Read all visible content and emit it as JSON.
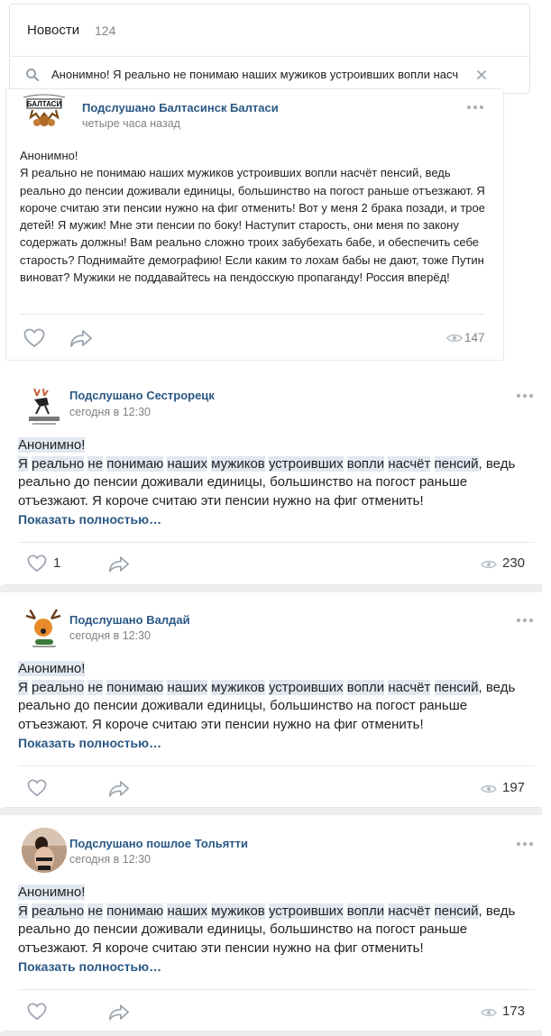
{
  "header": {
    "title": "Новости",
    "count": "124",
    "search_query": "Анонимно!  Я реально не понимаю наших мужиков устроивших вопли насч"
  },
  "posts": [
    {
      "author": "Подслушано Балтасинск Балтаси",
      "time": "четыре часа назад",
      "avatar_text": "БАЛТАСИ",
      "text": "Анонимно!\nЯ реально не понимаю наших мужиков устроивших вопли насчёт пенсий, ведь реально до пенсии доживали единицы, большинство на погост раньше отъезжают. Я короче считаю эти пенсии нужно на фиг отменить! Вот у меня 2 брака позади, и трое детей! Я мужик! Мне эти пенсии по боку! Наступит старость, они меня по закону содержать должны! Вам реально сложно троих забубехать бабе, и обеспечить себе старость? Поднимайте демографию! Если каким то лохам бабы не дают, тоже Путин виноват? Мужики не поддавайтесь на пендосскую пропаганду! Россия вперёд!",
      "views": "147"
    },
    {
      "author": "Подслушано Сестрорецк",
      "time": "сегодня в 12:30",
      "line1": "Анонимно!",
      "line2_words": [
        "Я",
        "реально",
        "не",
        "понимаю",
        "наших",
        "мужиков",
        "устроивших",
        "вопли",
        "насчёт",
        "пенсий"
      ],
      "line2_tail": ", ведь",
      "rest": "реально до пенсии доживали единицы, большинство на погост раньше отъезжают. Я короче считаю эти пенсии нужно на фиг отменить!",
      "more": "Показать полностью…",
      "likes": "1",
      "views": "230"
    },
    {
      "author": "Подслушано Валдай",
      "time": "сегодня в 12:30",
      "line1": "Анонимно!",
      "line2_words": [
        "Я",
        "реально",
        "не",
        "понимаю",
        "наших",
        "мужиков",
        "устроивших",
        "вопли",
        "насчёт",
        "пенсий"
      ],
      "line2_tail": ", ведь",
      "rest": "реально до пенсии доживали единицы, большинство на погост раньше отъезжают. Я короче считаю эти пенсии нужно на фиг отменить!",
      "more": "Показать полностью…",
      "views": "197"
    },
    {
      "author": "Подслушано пошлое Тольятти",
      "time": "сегодня в 12:30",
      "line1": "Анонимно!",
      "line2_words": [
        "Я",
        "реально",
        "не",
        "понимаю",
        "наших",
        "мужиков",
        "устроивших",
        "вопли",
        "насчёт",
        "пенсий"
      ],
      "line2_tail": ", ведь",
      "rest": "реально до пенсии доживали единицы, большинство на погост раньше отъезжают. Я короче считаю эти пенсии нужно на фиг отменить!",
      "more": "Показать полностью…",
      "views": "173"
    }
  ],
  "colors": {
    "link": "#2a5885",
    "muted": "#828282",
    "highlight": "#e2e8f0",
    "icon": "#a8aeb7"
  }
}
